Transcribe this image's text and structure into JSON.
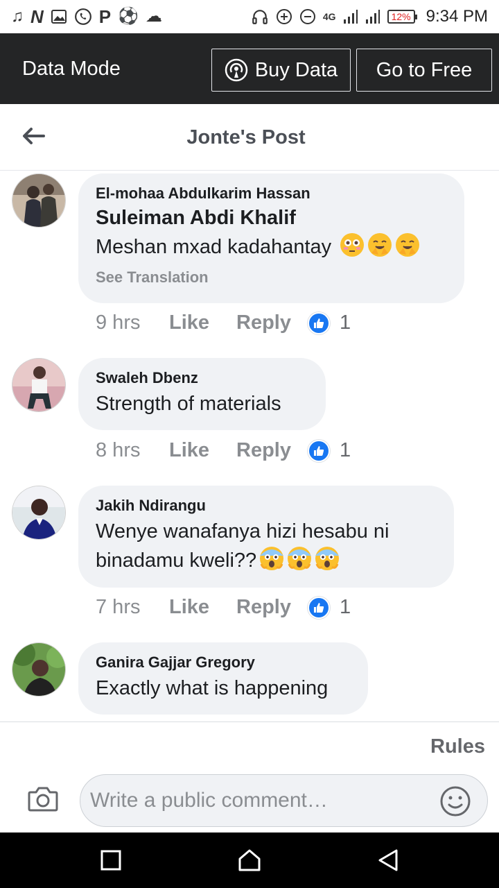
{
  "status_bar": {
    "left_icons": [
      "music-note-icon",
      "music-note-icon",
      "n-app-icon",
      "image-icon",
      "whatsapp-icon",
      "p-app-icon",
      "soccer-icon",
      "cloud-icon"
    ],
    "network_label": "4G",
    "battery": "12%",
    "time": "9:34 PM"
  },
  "data_bar": {
    "title": "Data Mode",
    "buy_label": "Buy Data",
    "free_label": "Go to Free"
  },
  "header": {
    "title": "Jonte's Post"
  },
  "comments": [
    {
      "author": "El-mohaa Abdulkarim Hassan",
      "mention": "Suleiman Abdi Khalif",
      "text": "Meshan mxad kadahantay",
      "emojis": [
        "flushed",
        "hugging",
        "hugging"
      ],
      "translation_label": "See Translation",
      "time": "9 hrs",
      "like_label": "Like",
      "reply_label": "Reply",
      "likes": "1"
    },
    {
      "author": "Swaleh Dbenz",
      "text": "Strength of materials",
      "time": "8 hrs",
      "like_label": "Like",
      "reply_label": "Reply",
      "likes": "1"
    },
    {
      "author": "Jakih Ndirangu",
      "text_line1": "Wenye  wanafanya  hizi  hesabu ni",
      "text_line2": "binadamu  kweli??",
      "emojis": [
        "screaming",
        "screaming",
        "screaming"
      ],
      "time": "7 hrs",
      "like_label": "Like",
      "reply_label": "Reply",
      "likes": "1"
    },
    {
      "author": "Ganira Gajjar Gregory",
      "text": "Exactly what is happening"
    }
  ],
  "composer": {
    "rules_label": "Rules",
    "placeholder": "Write a public comment…"
  },
  "colors": {
    "accent": "#1877f2",
    "dark_bar": "#242526",
    "bubble": "#f0f2f5",
    "muted_text": "#8a8d91"
  }
}
